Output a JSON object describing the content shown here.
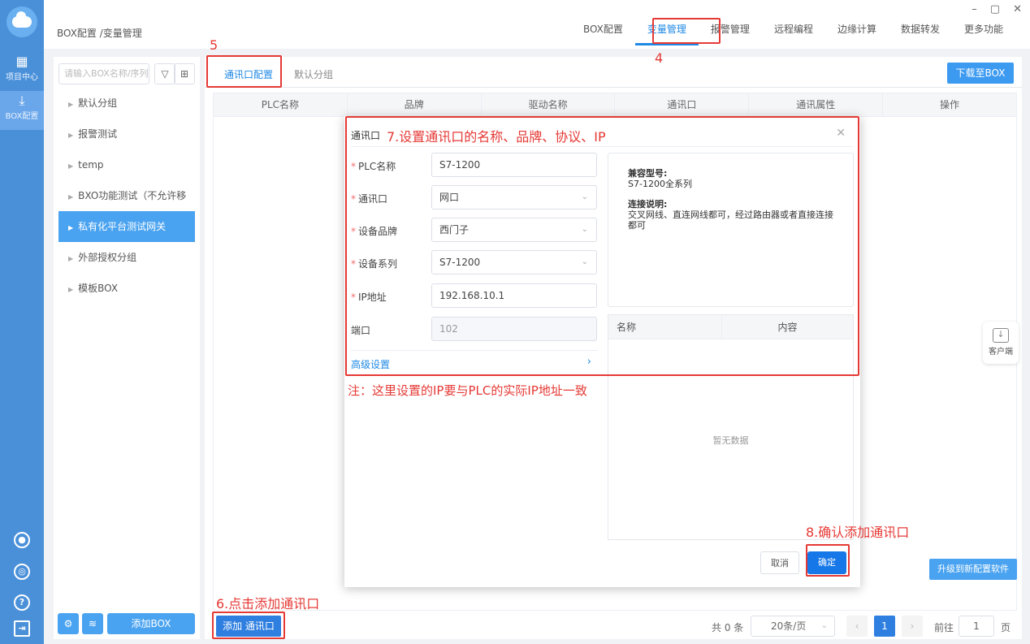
{
  "app": {
    "breadcrumb": "BOX配置 /变量管理",
    "window_controls": [
      "–",
      "▢",
      "✕"
    ]
  },
  "rail": {
    "items": [
      {
        "label": "项目中心",
        "icon": "grid-icon"
      },
      {
        "label": "BOX配置",
        "icon": "download-icon"
      }
    ]
  },
  "topnav": {
    "tabs": [
      {
        "label": "BOX配置"
      },
      {
        "label": "变量管理"
      },
      {
        "label": "报警管理"
      },
      {
        "label": "远程编程"
      },
      {
        "label": "边缘计算"
      },
      {
        "label": "数据转发"
      },
      {
        "label": "更多功能"
      }
    ],
    "active_index": 1
  },
  "side": {
    "search_placeholder": "请输入BOX名称/序列",
    "items": [
      {
        "label": "默认分组"
      },
      {
        "label": "报警测试"
      },
      {
        "label": "temp"
      },
      {
        "label": "BXO功能测试（不允许移动）"
      },
      {
        "label": "私有化平台测试网关"
      },
      {
        "label": "外部授权分组"
      },
      {
        "label": "模板BOX"
      }
    ],
    "active_index": 4,
    "add_box_label": "添加BOX"
  },
  "main": {
    "subtabs": [
      {
        "label": "通讯口配置"
      },
      {
        "label": "默认分组"
      }
    ],
    "download_label": "下载至BOX",
    "columns": [
      "PLC名称",
      "品牌",
      "驱动名称",
      "通讯口",
      "通讯属性",
      "操作"
    ],
    "add_port_label": "添加 通讯口",
    "pager": {
      "total": "共 0 条",
      "page_size": "20条/页",
      "current_page": "1",
      "goto_label": "前往",
      "goto_value": "1",
      "page_suffix": "页"
    },
    "client_label": "客户端",
    "upgrade_label": "升级到新配置软件"
  },
  "modal": {
    "title": "通讯口",
    "fields": [
      {
        "label": "PLC名称",
        "value": "S7-1200",
        "required": true
      },
      {
        "label": "通讯口",
        "value": "网口",
        "required": true
      },
      {
        "label": "设备品牌",
        "value": "西门子",
        "required": true
      },
      {
        "label": "设备系列",
        "value": "S7-1200",
        "required": true
      },
      {
        "label": "IP地址",
        "value": "192.168.10.1",
        "required": true
      },
      {
        "label": "端口",
        "value": "102",
        "required": false
      }
    ],
    "advanced_label": "高级设置",
    "compat_title": "兼容型号:",
    "compat_value": "S7-1200全系列",
    "conn_title": "连接说明:",
    "conn_value": "交叉网线、直连网线都可，经过路由器或者直接连接都可",
    "param_columns": [
      "名称",
      "内容"
    ],
    "empty_text": "暂无数据",
    "cancel_label": "取消",
    "ok_label": "确定"
  },
  "annotations": {
    "n4": "4",
    "n5": "5",
    "n6": "6.点击添加通讯口",
    "n7": "7.设置通讯口的名称、品牌、协议、IP",
    "n8": "8.确认添加通讯口",
    "note": "注：这里设置的IP要与PLC的实际IP地址一致",
    "color": "#e53935"
  }
}
